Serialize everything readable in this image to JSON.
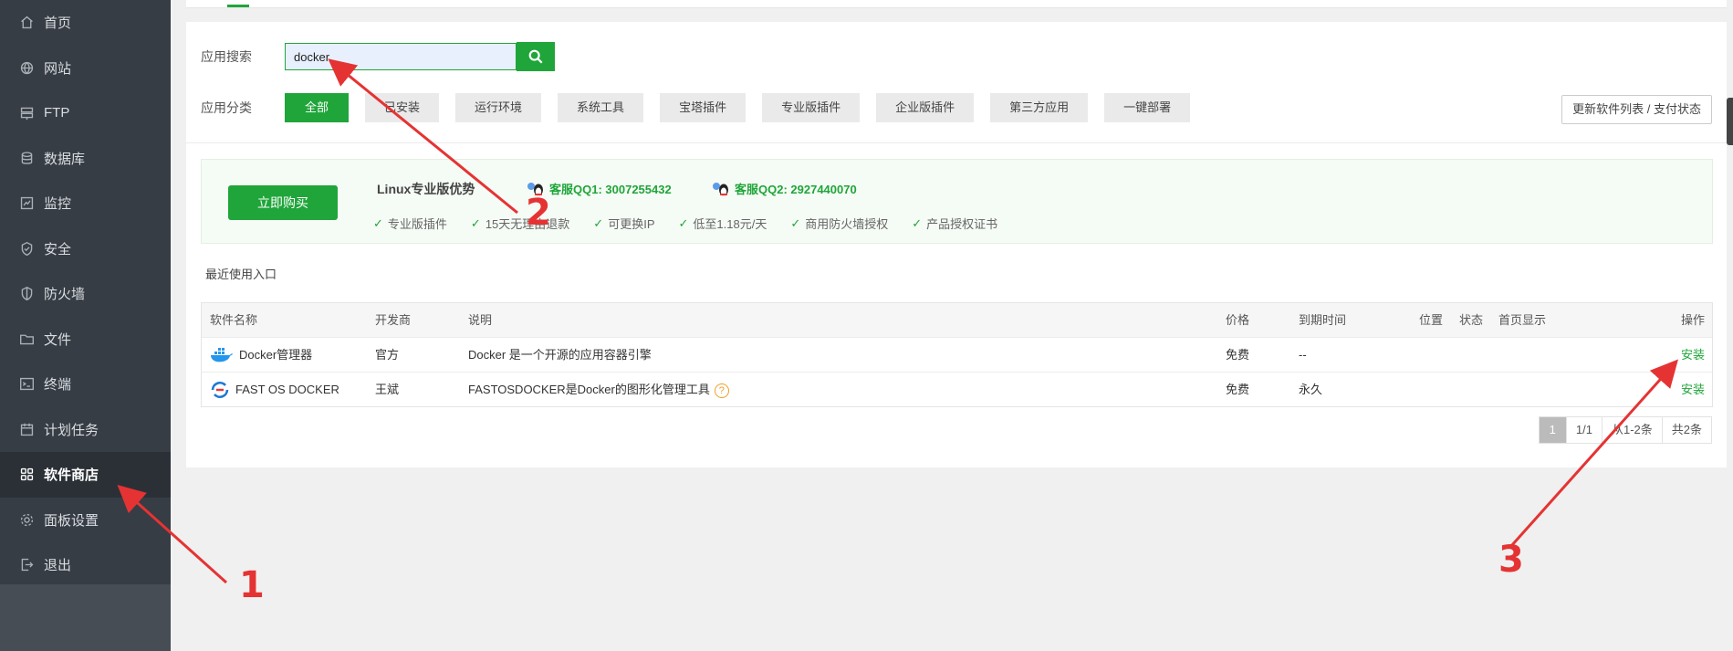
{
  "sidebar": {
    "items": [
      {
        "label": "首页",
        "icon": "home-icon"
      },
      {
        "label": "网站",
        "icon": "globe-icon"
      },
      {
        "label": "FTP",
        "icon": "ftp-icon"
      },
      {
        "label": "数据库",
        "icon": "database-icon"
      },
      {
        "label": "监控",
        "icon": "monitor-icon"
      },
      {
        "label": "安全",
        "icon": "shield-check-icon"
      },
      {
        "label": "防火墙",
        "icon": "firewall-icon"
      },
      {
        "label": "文件",
        "icon": "folder-icon"
      },
      {
        "label": "终端",
        "icon": "terminal-icon"
      },
      {
        "label": "计划任务",
        "icon": "calendar-icon"
      },
      {
        "label": "软件商店",
        "icon": "grid-icon",
        "active": true
      },
      {
        "label": "面板设置",
        "icon": "gear-icon"
      },
      {
        "label": "退出",
        "icon": "logout-icon"
      }
    ]
  },
  "search": {
    "label": "应用搜索",
    "value": "docker"
  },
  "categories": {
    "label": "应用分类",
    "items": [
      "全部",
      "已安装",
      "运行环境",
      "系统工具",
      "宝塔插件",
      "专业版插件",
      "企业版插件",
      "第三方应用",
      "一键部署"
    ],
    "update_label": "更新软件列表 / 支付状态"
  },
  "promo": {
    "buy_label": "立即购买",
    "title": "Linux专业版优势",
    "qq1": "客服QQ1: 3007255432",
    "qq2": "客服QQ2: 2927440070",
    "features": [
      "专业版插件",
      "15天无理由退款",
      "可更换IP",
      "低至1.18元/天",
      "商用防火墙授权",
      "产品授权证书"
    ]
  },
  "recent_label": "最近使用入口",
  "table": {
    "headers": {
      "name": "软件名称",
      "dev": "开发商",
      "desc": "说明",
      "price": "价格",
      "expire": "到期时间",
      "pos": "位置",
      "status": "状态",
      "home": "首页显示",
      "op": "操作"
    },
    "rows": [
      {
        "name": "Docker管理器",
        "dev": "官方",
        "desc": "Docker 是一个开源的应用容器引擎",
        "price": "免费",
        "expire": "--",
        "op": "安装",
        "icon": "docker-whale-icon"
      },
      {
        "name": "FAST OS DOCKER",
        "dev": "王斌",
        "desc": "FASTOSDOCKER是Docker的图形化管理工具",
        "price": "免费",
        "expire": "永久",
        "op": "安装",
        "icon": "fastos-logo-icon"
      }
    ]
  },
  "pager": {
    "current": "1",
    "pages": "1/1",
    "range": "从1-2条",
    "total": "共2条"
  },
  "annotations": [
    "1",
    "2",
    "3"
  ],
  "colors": {
    "accent": "#20a53a",
    "sidebar": "#373d44",
    "annotation": "#e53333"
  }
}
